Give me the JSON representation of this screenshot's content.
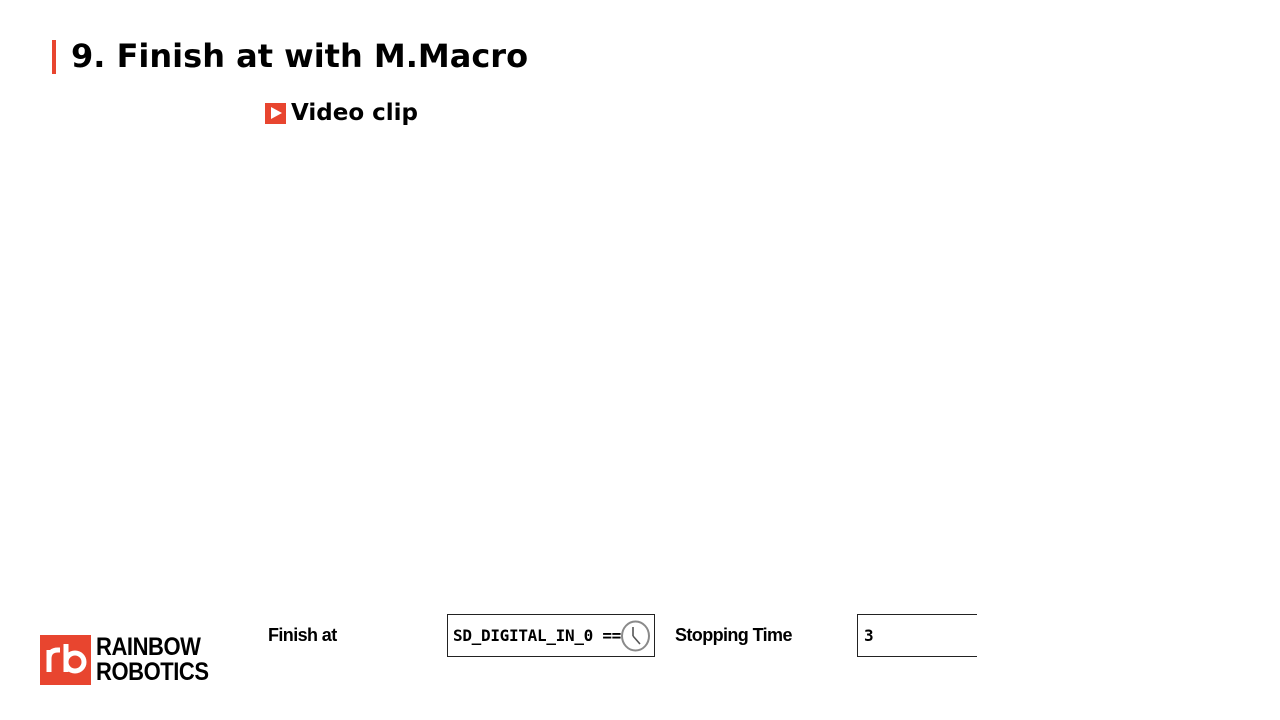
{
  "slide": {
    "title": "9. Finish at with M.Macro",
    "video_link_label": "Video clip"
  },
  "form": {
    "finish_at_label": "Finish at",
    "finish_at_value": "SD_DIGITAL_IN_0 ==",
    "stopping_time_label": "Stopping Time",
    "stopping_time_value": "3"
  },
  "logo": {
    "line1": "RAINBOW",
    "line2": "ROBOTICS"
  },
  "colors": {
    "accent": "#e8452f"
  },
  "icons": {
    "play": "play-icon",
    "clock": "clock-icon"
  }
}
